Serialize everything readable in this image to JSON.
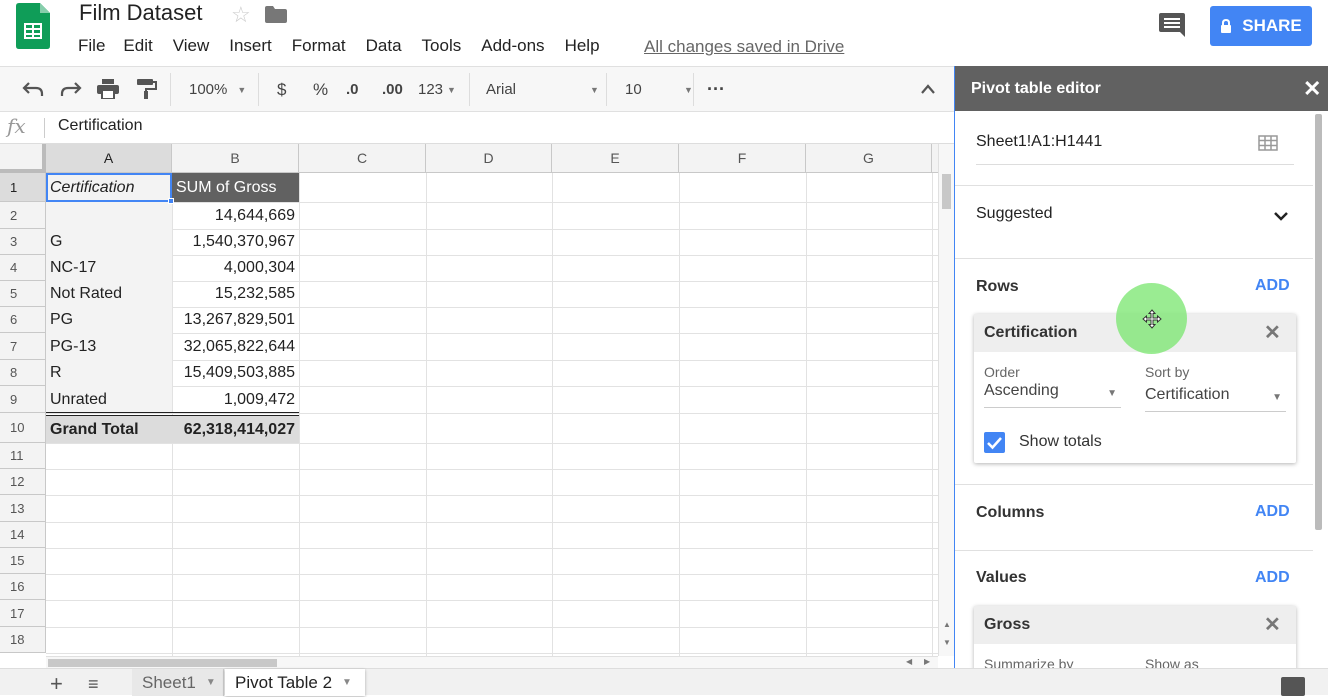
{
  "header": {
    "title": "Film Dataset",
    "menu": [
      "File",
      "Edit",
      "View",
      "Insert",
      "Format",
      "Data",
      "Tools",
      "Add-ons",
      "Help"
    ],
    "saved_status": "All changes saved in Drive",
    "share_label": "SHARE"
  },
  "toolbar": {
    "zoom": "100%",
    "currency": "$",
    "percent": "%",
    "dec_decrease": ".0",
    "dec_increase": ".00",
    "format_more": "123",
    "font": "Arial",
    "font_size": "10",
    "more": "···"
  },
  "formula_bar": {
    "fx": "fx",
    "value": "Certification"
  },
  "grid": {
    "columns": [
      "A",
      "B",
      "C",
      "D",
      "E",
      "F",
      "G"
    ],
    "rows": [
      "1",
      "2",
      "3",
      "4",
      "5",
      "6",
      "7",
      "8",
      "9",
      "10",
      "11",
      "12",
      "13",
      "14",
      "15",
      "16",
      "17",
      "18"
    ],
    "header_a": "Certification",
    "header_b": "SUM of Gross",
    "data": [
      {
        "cert": "",
        "gross": "14,644,669"
      },
      {
        "cert": "G",
        "gross": "1,540,370,967"
      },
      {
        "cert": "NC-17",
        "gross": "4,000,304"
      },
      {
        "cert": "Not Rated",
        "gross": "15,232,585"
      },
      {
        "cert": "PG",
        "gross": "13,267,829,501"
      },
      {
        "cert": "PG-13",
        "gross": "32,065,822,644"
      },
      {
        "cert": "R",
        "gross": "15,409,503,885"
      },
      {
        "cert": "Unrated",
        "gross": "1,009,472"
      }
    ],
    "total_label": "Grand Total",
    "total_value": "62,318,414,027"
  },
  "tabs": {
    "sheet1": "Sheet1",
    "pivot": "Pivot Table 2"
  },
  "pivot_editor": {
    "title": "Pivot table editor",
    "close": "✕",
    "range": "Sheet1!A1:H1441",
    "suggested": "Suggested",
    "rows_title": "Rows",
    "add": "ADD",
    "row_field": {
      "name": "Certification",
      "order_label": "Order",
      "order_value": "Ascending",
      "sortby_label": "Sort by",
      "sortby_value": "Certification",
      "show_totals": "Show totals"
    },
    "columns_title": "Columns",
    "values_title": "Values",
    "value_field": {
      "name": "Gross",
      "summarize_label": "Summarize by",
      "show_as_label": "Show as"
    }
  },
  "colors": {
    "accent": "#4285f4",
    "pivot_header": "#616161",
    "sheets_green": "#0f9d58"
  }
}
